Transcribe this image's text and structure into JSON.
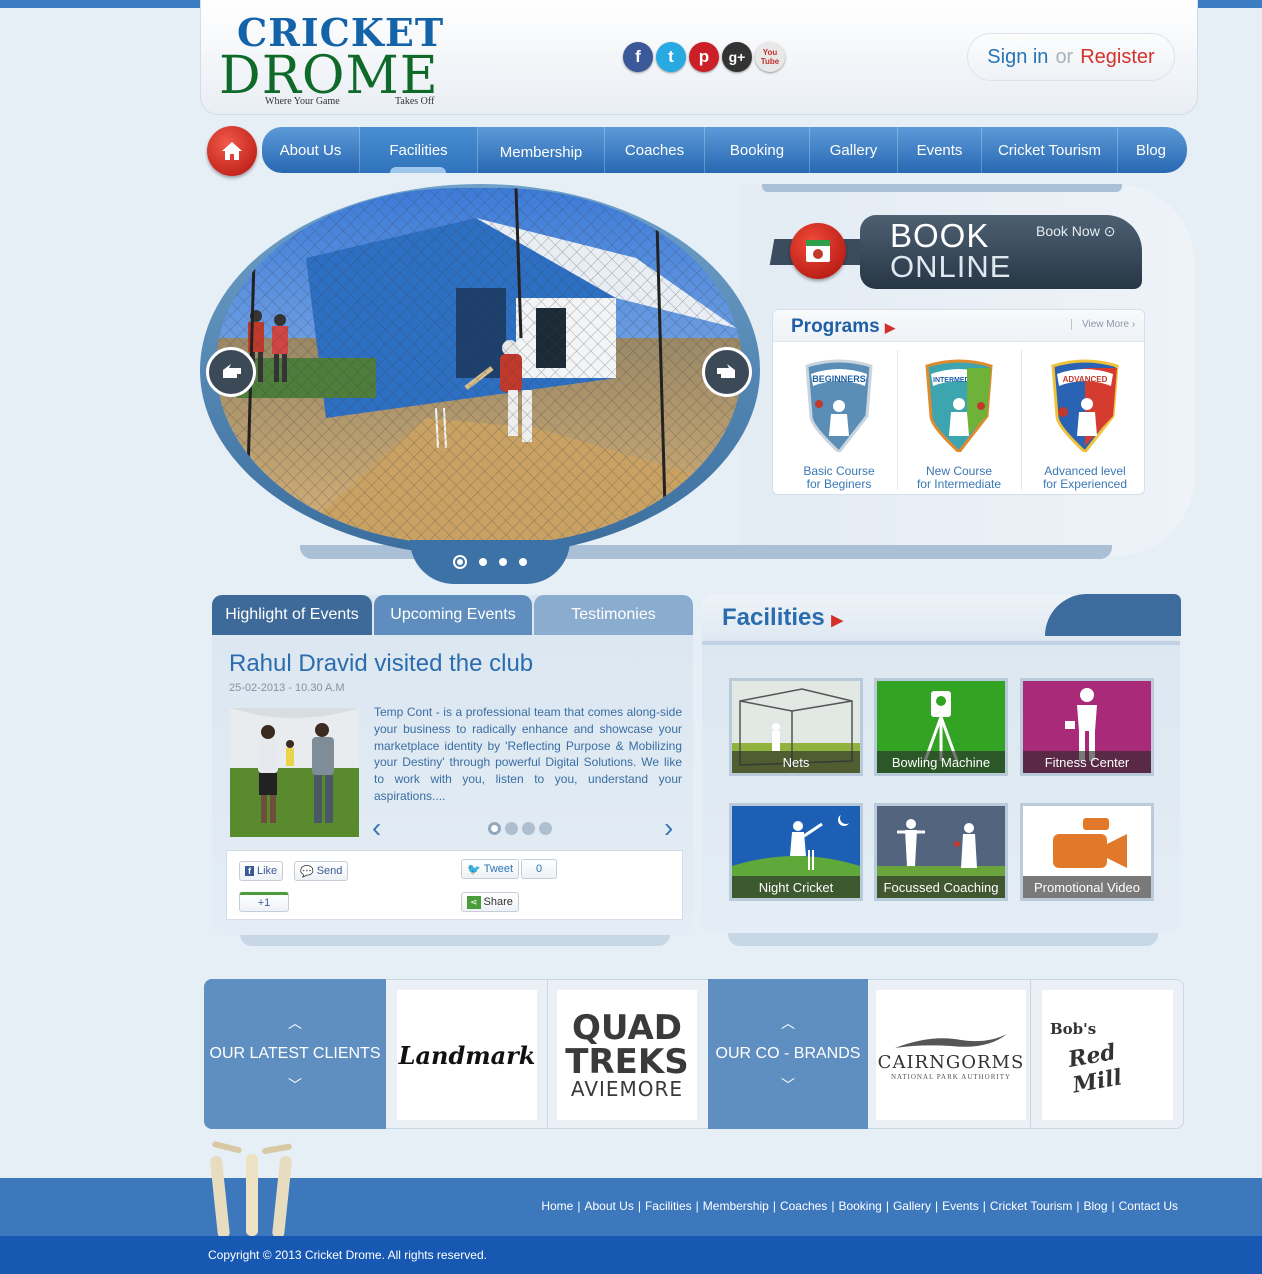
{
  "header": {
    "logo_top": "CRICKET",
    "logo_main": "DROME",
    "logo_tagline_left": "Where Your Game",
    "logo_tagline_right": "Takes Off",
    "sign_in": "Sign in",
    "or": "or",
    "register": "Register"
  },
  "social": [
    {
      "name": "facebook",
      "glyph": "f",
      "color": "#3b5998"
    },
    {
      "name": "twitter",
      "glyph": "t",
      "color": "#29a9e1"
    },
    {
      "name": "pinterest",
      "glyph": "p",
      "color": "#cb2027"
    },
    {
      "name": "google-plus",
      "glyph": "g+",
      "color": "#333333"
    },
    {
      "name": "youtube",
      "glyph": "You Tube",
      "color": "#d7d7d7"
    }
  ],
  "nav": {
    "items": [
      "About Us",
      "Facilities",
      "Membership",
      "Coaches",
      "Booking",
      "Gallery",
      "Events",
      "Cricket Tourism",
      "Blog"
    ],
    "active": "Facilities"
  },
  "book": {
    "line1": "BOOK",
    "line2": "ONLINE",
    "book_now": "Book Now"
  },
  "programs": {
    "title": "Programs",
    "view_more": "View More",
    "items": [
      {
        "badge": "BEGINNERS",
        "line1": "Basic Course",
        "line2": "for Beginers"
      },
      {
        "badge": "INTERMEDIATE",
        "line1": "New Course",
        "line2": "for Intermediate"
      },
      {
        "badge": "ADVANCED",
        "line1": "Advanced level",
        "line2": "for Experienced"
      }
    ]
  },
  "slider": {
    "slide_count": 4,
    "active_slide": 1
  },
  "events": {
    "tabs": [
      "Highlight of Events",
      "Upcoming Events",
      "Testimonies"
    ],
    "title": "Rahul Dravid visited the club",
    "date": "25-02-2013 - 10.30 A.M",
    "body": "Temp Cont - is a professional team that comes along-side your business to radically enhance and showcase your marketplace identity by 'Reflecting Purpose & Mobilizing your Destiny' through powerful Digital Solutions. We like to work with you, listen to you, understand your aspirations....",
    "like": "Like",
    "send": "Send",
    "tweet": "Tweet",
    "tweet_count": "0",
    "plus_one": "+1",
    "share": "Share"
  },
  "facilities": {
    "title": "Facilities",
    "tiles": [
      "Nets",
      "Bowling Machine",
      "Fitness Center",
      "Night Cricket",
      "Focussed Coaching",
      "Promotional Video"
    ]
  },
  "clients": {
    "label_clients": "OUR LATEST CLIENTS",
    "label_brands": "OUR CO - BRANDS",
    "logo_landmark": "Landmark",
    "logo_quad_1": "QUAD",
    "logo_quad_2": "TREKS",
    "logo_quad_3": "AVIEMORE",
    "logo_cairngorms": "CAIRNGORMS",
    "logo_cairngorms_sub": "NATIONAL PARK AUTHORITY",
    "logo_redmill_1": "Bob's",
    "logo_redmill_2": "Red Mill"
  },
  "footer": {
    "links": [
      "Home",
      "About Us",
      "Facilities",
      "Membership",
      "Coaches",
      "Booking",
      "Gallery",
      "Events",
      "Cricket Tourism",
      "Blog",
      "Contact Us"
    ],
    "copyright": "Copyright  © 2013 Cricket Drome. All rights reserved."
  }
}
